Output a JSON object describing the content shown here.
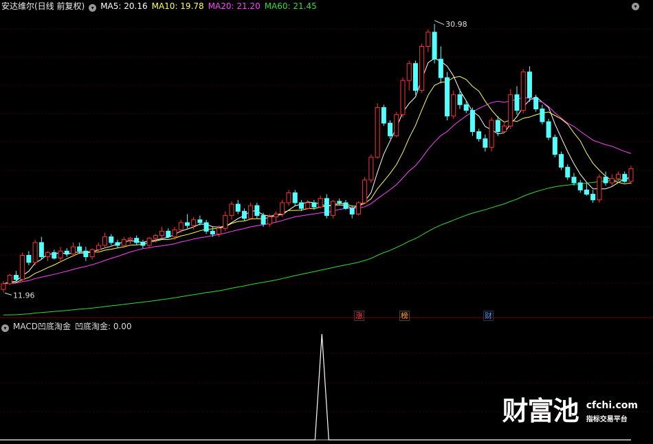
{
  "header": {
    "title": "安达维尔(日线 前复权)",
    "ma": [
      {
        "label": "MA5: 20.16",
        "color": "#ffffff"
      },
      {
        "label": "MA10: 19.78",
        "color": "#ffff55"
      },
      {
        "label": "MA20: 21.20",
        "color": "#ff44ff"
      },
      {
        "label": "MA60: 21.45",
        "color": "#33dd33"
      }
    ]
  },
  "price_markers": {
    "high": "30.98",
    "low": "11.96"
  },
  "events": [
    {
      "label": "涨",
      "color": "#ff4444"
    },
    {
      "label": "榜",
      "color": "#ffaa33"
    },
    {
      "label": "财",
      "color": "#4499ff"
    }
  ],
  "indicator": {
    "name": "MACD凹底淘金",
    "value_label": "凹底淘金: 0.00"
  },
  "watermark": {
    "brand": "财富池",
    "domain": "cfchi.com",
    "slogan": "指标交易平台"
  },
  "colors": {
    "up": "#ff3232",
    "down": "#54ffff",
    "grid": "#3c0000"
  },
  "chart_data": {
    "type": "candlestick",
    "price_range": [
      11.0,
      31.6
    ],
    "candles": [
      [
        12.3,
        12.9,
        12.1,
        12.7
      ],
      [
        12.7,
        13.4,
        12.6,
        13.3
      ],
      [
        13.3,
        13.6,
        12.9,
        13.0
      ],
      [
        13.0,
        14.9,
        12.9,
        14.7
      ],
      [
        14.7,
        15.0,
        14.0,
        14.2
      ],
      [
        14.2,
        15.8,
        14.0,
        15.6
      ],
      [
        15.6,
        16.0,
        14.4,
        14.6
      ],
      [
        14.6,
        15.0,
        14.3,
        14.9
      ],
      [
        14.9,
        15.1,
        14.4,
        14.5
      ],
      [
        14.5,
        15.3,
        14.2,
        15.0
      ],
      [
        15.0,
        15.2,
        14.6,
        14.8
      ],
      [
        14.8,
        15.6,
        14.6,
        15.3
      ],
      [
        15.3,
        15.6,
        14.8,
        15.0
      ],
      [
        15.0,
        15.3,
        14.3,
        14.6
      ],
      [
        14.6,
        15.2,
        14.4,
        15.1
      ],
      [
        15.1,
        15.6,
        14.9,
        15.4
      ],
      [
        15.4,
        16.3,
        15.2,
        16.0
      ],
      [
        16.0,
        16.2,
        15.4,
        15.6
      ],
      [
        15.6,
        15.8,
        15.2,
        15.4
      ],
      [
        15.4,
        16.0,
        15.2,
        15.8
      ],
      [
        15.8,
        16.0,
        15.5,
        15.9
      ],
      [
        15.9,
        16.1,
        15.4,
        15.6
      ],
      [
        15.6,
        15.8,
        15.2,
        15.4
      ],
      [
        15.4,
        16.0,
        15.2,
        15.9
      ],
      [
        15.9,
        16.2,
        15.6,
        16.1
      ],
      [
        16.1,
        16.7,
        15.9,
        16.4
      ],
      [
        16.4,
        16.6,
        15.9,
        16.0
      ],
      [
        16.0,
        16.7,
        15.8,
        16.5
      ],
      [
        16.5,
        17.2,
        16.3,
        17.0
      ],
      [
        17.0,
        17.6,
        16.6,
        16.8
      ],
      [
        16.8,
        17.4,
        16.5,
        17.2
      ],
      [
        17.2,
        17.5,
        16.8,
        17.0
      ],
      [
        17.0,
        17.2,
        16.2,
        16.4
      ],
      [
        16.4,
        16.7,
        16.0,
        16.2
      ],
      [
        16.2,
        16.8,
        16.0,
        16.6
      ],
      [
        16.6,
        17.8,
        16.4,
        17.5
      ],
      [
        17.5,
        18.5,
        17.2,
        18.3
      ],
      [
        18.3,
        18.6,
        17.6,
        17.8
      ],
      [
        17.8,
        18.0,
        17.1,
        17.3
      ],
      [
        17.3,
        18.4,
        17.2,
        18.2
      ],
      [
        18.2,
        18.4,
        17.3,
        17.5
      ],
      [
        17.5,
        17.7,
        16.7,
        16.9
      ],
      [
        16.9,
        17.6,
        16.7,
        17.4
      ],
      [
        17.4,
        17.8,
        17.0,
        17.6
      ],
      [
        17.6,
        18.6,
        17.4,
        18.4
      ],
      [
        18.4,
        19.3,
        18.2,
        19.1
      ],
      [
        19.1,
        19.3,
        18.2,
        18.4
      ],
      [
        18.4,
        18.6,
        17.8,
        18.0
      ],
      [
        18.0,
        18.6,
        17.9,
        18.4
      ],
      [
        18.4,
        18.6,
        17.9,
        18.1
      ],
      [
        18.1,
        18.9,
        18.0,
        18.7
      ],
      [
        18.7,
        19.0,
        17.3,
        17.5
      ],
      [
        17.5,
        18.6,
        17.3,
        18.5
      ],
      [
        18.5,
        18.7,
        18.2,
        18.4
      ],
      [
        18.4,
        18.6,
        17.9,
        18.0
      ],
      [
        18.0,
        18.2,
        17.3,
        17.6
      ],
      [
        17.6,
        18.5,
        17.5,
        18.4
      ],
      [
        18.4,
        20.2,
        18.3,
        20.0
      ],
      [
        20.0,
        21.8,
        19.8,
        21.6
      ],
      [
        21.6,
        25.4,
        21.5,
        25.1
      ],
      [
        25.1,
        25.3,
        23.8,
        24.0
      ],
      [
        24.0,
        24.2,
        22.9,
        23.1
      ],
      [
        23.1,
        24.8,
        23.0,
        24.6
      ],
      [
        24.6,
        27.2,
        24.4,
        27.0
      ],
      [
        27.0,
        28.4,
        26.3,
        28.2
      ],
      [
        28.2,
        28.4,
        26.0,
        26.3
      ],
      [
        26.3,
        29.6,
        26.1,
        29.4
      ],
      [
        29.4,
        30.6,
        29.0,
        30.4
      ],
      [
        30.4,
        30.98,
        28.2,
        28.5
      ],
      [
        28.5,
        29.4,
        26.8,
        27.2
      ],
      [
        27.2,
        27.6,
        24.2,
        24.5
      ],
      [
        24.5,
        26.3,
        24.3,
        26.0
      ],
      [
        26.0,
        26.4,
        25.0,
        25.3
      ],
      [
        25.3,
        25.6,
        24.7,
        24.9
      ],
      [
        24.9,
        25.1,
        23.1,
        23.4
      ],
      [
        23.4,
        23.6,
        22.7,
        22.9
      ],
      [
        22.9,
        23.2,
        22.0,
        22.3
      ],
      [
        22.3,
        24.4,
        22.0,
        24.2
      ],
      [
        24.2,
        24.5,
        23.1,
        23.4
      ],
      [
        23.4,
        24.0,
        23.3,
        23.8
      ],
      [
        23.8,
        26.4,
        23.6,
        26.0
      ],
      [
        26.0,
        26.6,
        24.6,
        24.9
      ],
      [
        24.9,
        27.8,
        24.7,
        27.6
      ],
      [
        27.6,
        28.0,
        25.5,
        25.8
      ],
      [
        25.8,
        26.0,
        24.8,
        25.0
      ],
      [
        25.0,
        25.3,
        23.9,
        24.1
      ],
      [
        24.1,
        24.3,
        22.8,
        23.0
      ],
      [
        23.0,
        23.2,
        21.6,
        21.8
      ],
      [
        21.8,
        22.0,
        20.7,
        20.9
      ],
      [
        20.9,
        21.1,
        20.0,
        20.2
      ],
      [
        20.2,
        20.5,
        19.6,
        19.8
      ],
      [
        19.8,
        20.0,
        19.1,
        19.3
      ],
      [
        19.3,
        19.8,
        18.9,
        19.0
      ],
      [
        19.0,
        19.3,
        18.4,
        18.6
      ],
      [
        18.6,
        20.4,
        18.4,
        20.2
      ],
      [
        20.2,
        20.6,
        19.6,
        19.8
      ],
      [
        19.8,
        20.4,
        19.6,
        20.1
      ],
      [
        20.1,
        20.6,
        19.9,
        20.4
      ],
      [
        20.4,
        20.6,
        19.8,
        19.9
      ],
      [
        19.9,
        21.0,
        19.7,
        20.8
      ]
    ],
    "ma": {
      "periods": [
        5,
        10,
        20,
        60
      ],
      "last_values": [
        20.16,
        19.78,
        21.2,
        21.45
      ]
    },
    "indicator_series": {
      "name": "凹底淘金",
      "spike_index": 51,
      "spike_value": 1,
      "current_value": 0.0
    }
  }
}
